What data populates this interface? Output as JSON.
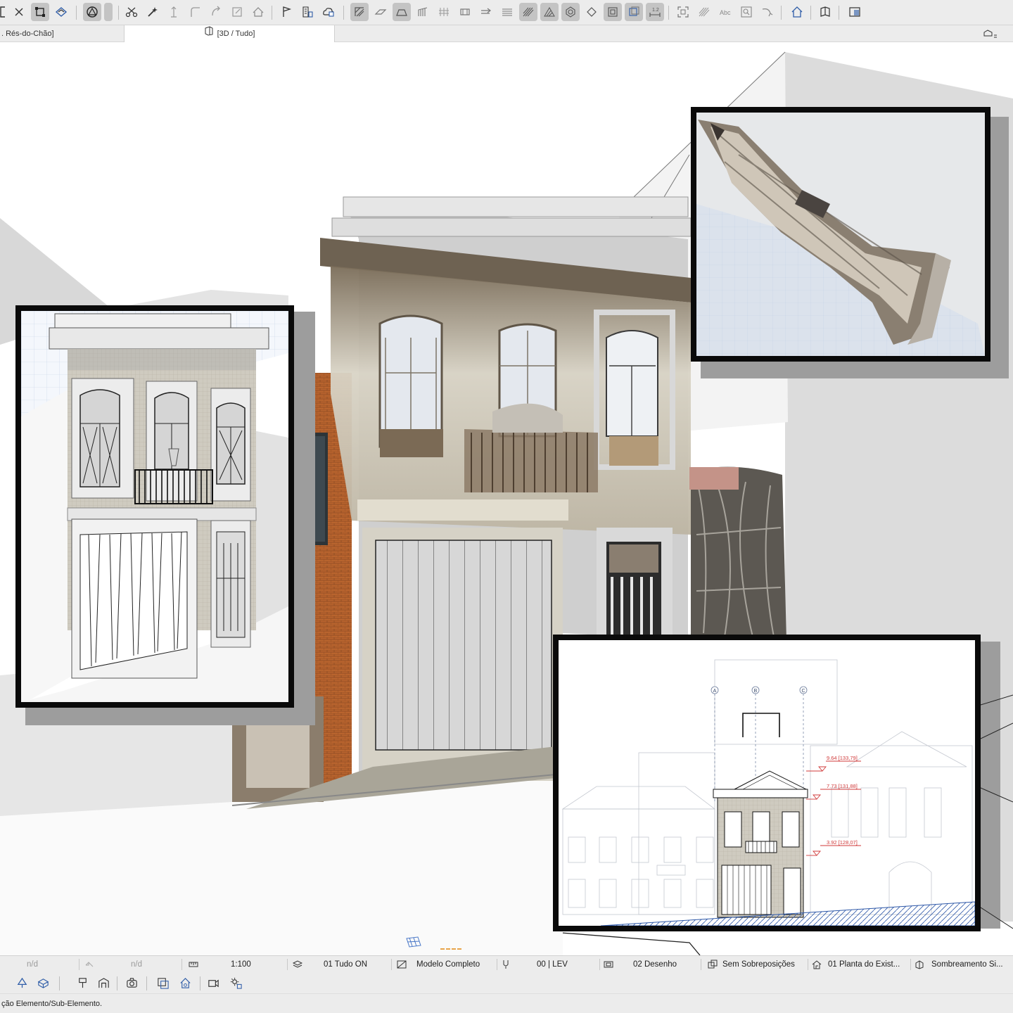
{
  "tabs": {
    "floor_plan": ". Rés-do-Chão]",
    "view_3d": "[3D / Tudo]"
  },
  "toolbar_icons": [
    "arrow-tool-icon",
    "marquee-icon",
    "element-select-icon",
    "trace-icon",
    "gravity-icon",
    "scissors-icon",
    "magic-wand-icon",
    "elevation-tool-icon",
    "fillet-icon",
    "rotate-icon",
    "resize-icon",
    "roof-icon",
    "flag-icon",
    "schedule-icon",
    "cloud-icon",
    "wall-hatch-icon",
    "slab-icon",
    "arch-icon",
    "stair-icon",
    "grid-icon",
    "beam-icon",
    "arrow-right-icon",
    "hatch-icon",
    "hatch-active-icon",
    "hatch-diagonal-icon",
    "node-icon",
    "diamond-icon",
    "layer-icon",
    "layer-stack-icon",
    "dimension-icon",
    "frame-icon",
    "fill-icon",
    "text-icon",
    "zoom-icon",
    "curve-icon",
    "house-icon",
    "book-icon",
    "layout-icon"
  ],
  "status": {
    "nd1": "n/d",
    "nd2": "n/d",
    "scale": "1:100",
    "layers": "01 Tudo ON",
    "model": "Modelo Completo",
    "pen": "00 | LEV",
    "drawing": "02 Desenho",
    "overrides": "Sem Sobreposições",
    "plan": "01 Planta do Exist...",
    "shading": "Sombreamento Si..."
  },
  "toolbar2_icons": [
    "tree-icon",
    "3d-box-icon",
    "paint-icon",
    "render-icon",
    "camera-icon",
    "copy-view-icon",
    "house-cog-icon",
    "video-camera-icon",
    "sun-settings-icon"
  ],
  "hint": "ção Elemento/Sub-Elemento.",
  "elevation_drawing": {
    "grid_labels": [
      "A",
      "B",
      "C"
    ],
    "levels": [
      "9.64 [133,79]",
      "7.73 [131,88]",
      "3.92 [128,07]"
    ]
  },
  "colors": {
    "chrome": "#ececec",
    "active_tab": "#ffffff",
    "marker": "#e8a44a",
    "level_red": "#d03a3a",
    "panel_border": "#0a0a0a"
  }
}
